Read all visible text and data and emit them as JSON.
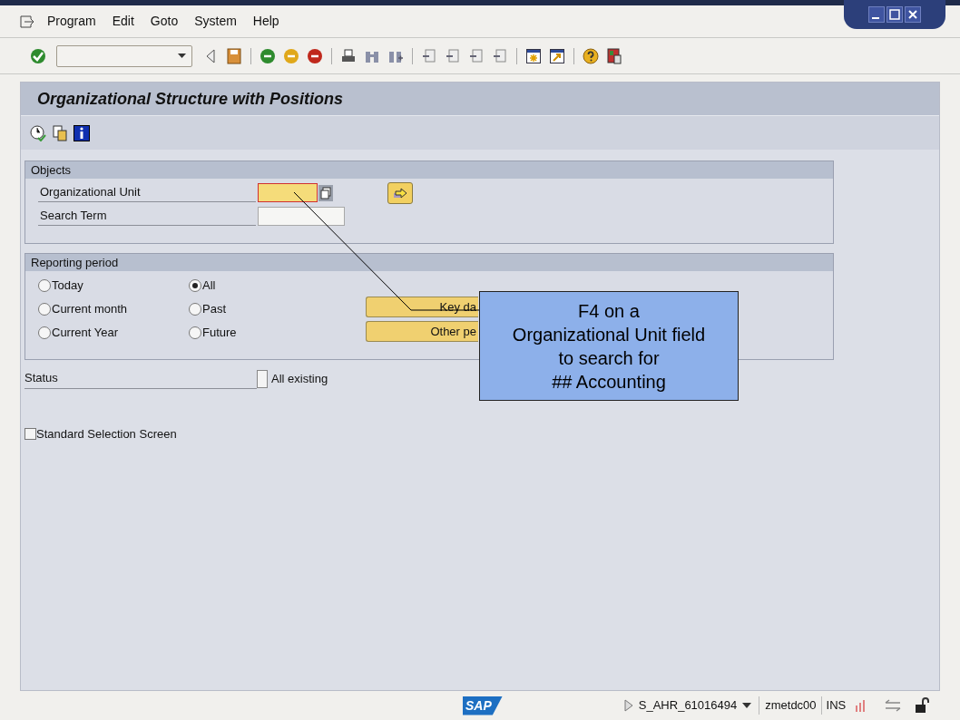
{
  "menu": [
    "Program",
    "Edit",
    "Goto",
    "System",
    "Help"
  ],
  "title": "Organizational Structure with Positions",
  "objects": {
    "title": "Objects",
    "fields": [
      {
        "label": "Organizational Unit",
        "focused": true
      },
      {
        "label": "Search Term",
        "focused": false
      }
    ]
  },
  "reporting_period": {
    "title": "Reporting period",
    "options": [
      {
        "label": "Today",
        "selected": false
      },
      {
        "label": "All",
        "selected": true
      },
      {
        "label": "Current month",
        "selected": false
      },
      {
        "label": "Past",
        "selected": false
      },
      {
        "label": "Current Year",
        "selected": false
      },
      {
        "label": "Future",
        "selected": false
      }
    ],
    "buttons": [
      "Key da",
      "Other pe"
    ]
  },
  "status": {
    "label": "Status",
    "option": "All existing",
    "checked": false
  },
  "standard_selection": {
    "label": "Standard Selection Screen",
    "checked": false
  },
  "callout": [
    "F4 on a",
    "Organizational Unit field",
    "to search for",
    "## Accounting"
  ],
  "status_bar": {
    "logo": "SAP",
    "system": "S_AHR_61016494",
    "server": "zmetdc00",
    "mode": "INS"
  }
}
